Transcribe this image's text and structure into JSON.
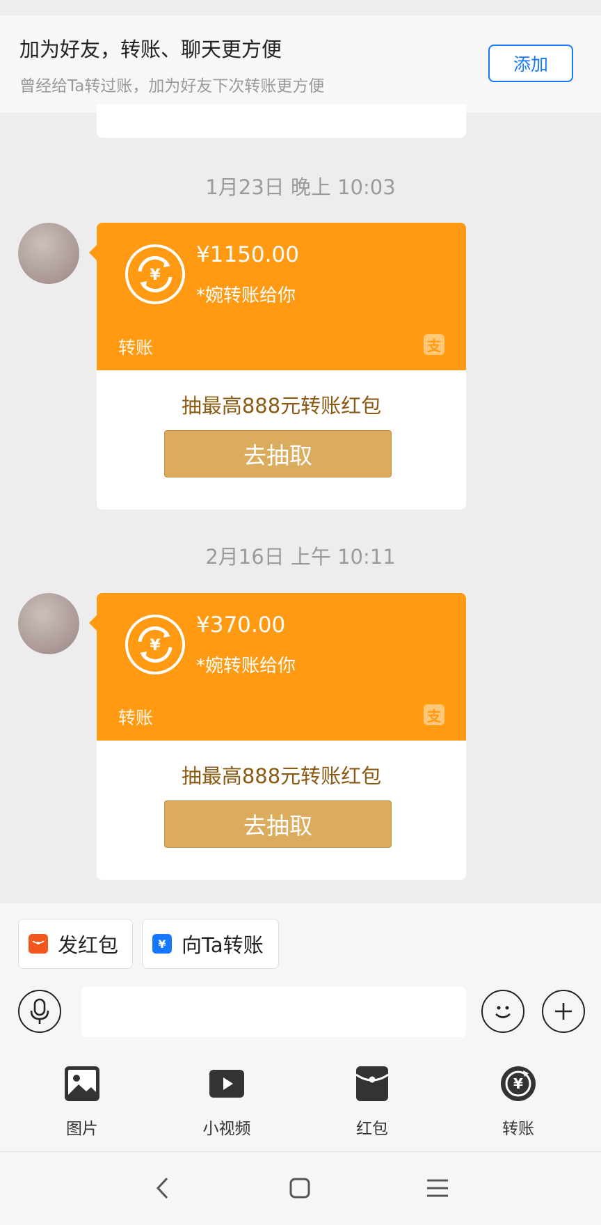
{
  "banner": {
    "title": "加为好友，转账、聊天更方便",
    "subtitle": "曾经给Ta转过账，加为好友下次转账更方便",
    "add_label": "添加"
  },
  "messages": [
    {
      "timestamp": "1月23日 晚上 10:03",
      "amount": "¥1150.00",
      "sender": "*婉转账给你",
      "kind": "转账",
      "alipay_glyph": "支",
      "promo": "抽最高888元转账红包",
      "button": "去抽取"
    },
    {
      "timestamp": "2月16日 上午 10:11",
      "amount": "¥370.00",
      "sender": "*婉转账给你",
      "kind": "转账",
      "alipay_glyph": "支",
      "promo": "抽最高888元转账红包",
      "button": "去抽取"
    }
  ],
  "quick_actions": [
    {
      "label": "发红包",
      "icon": "red-packet-icon",
      "color": "#f0561d"
    },
    {
      "label": "向Ta转账",
      "icon": "transfer-icon",
      "color": "#1677ff"
    }
  ],
  "input": {
    "placeholder": ""
  },
  "tools": [
    {
      "label": "图片",
      "icon": "image-icon"
    },
    {
      "label": "小视频",
      "icon": "video-icon"
    },
    {
      "label": "红包",
      "icon": "red-packet-icon"
    },
    {
      "label": "转账",
      "icon": "transfer-yuan-icon"
    }
  ],
  "colors": {
    "transfer_orange": "#ff9a12",
    "draw_button": "#dcac5e",
    "promo_text": "#8b5a12",
    "link_blue": "#1677ff"
  }
}
